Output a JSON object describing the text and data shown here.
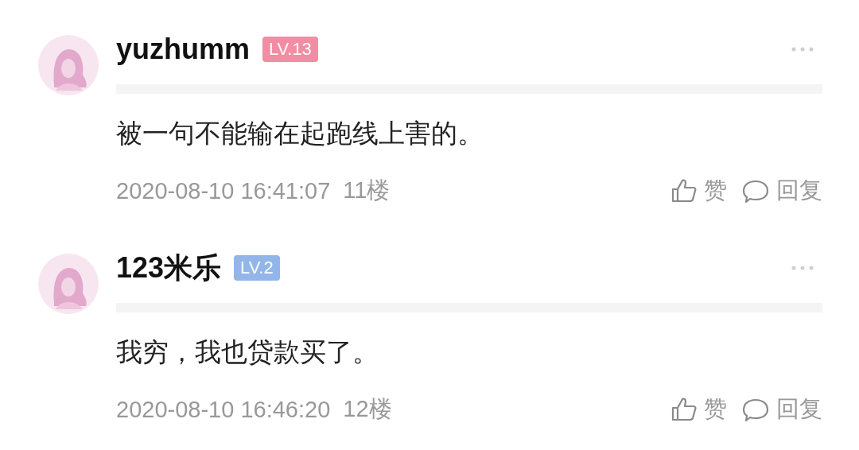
{
  "comments": [
    {
      "username": "yuzhumm",
      "level_badge": {
        "text": "LV.13",
        "color": "#f28da4"
      },
      "content": "被一句不能输在起跑线上害的。",
      "time": "2020-08-10 16:41:07",
      "floor": "11楼",
      "like_label": "赞",
      "reply_label": "回复"
    },
    {
      "username": "123米乐",
      "level_badge": {
        "text": "LV.2",
        "color": "#92b6e9"
      },
      "content": "我穷，我也贷款买了。",
      "time": "2020-08-10 16:46:20",
      "floor": "12楼",
      "like_label": "赞",
      "reply_label": "回复"
    }
  ]
}
